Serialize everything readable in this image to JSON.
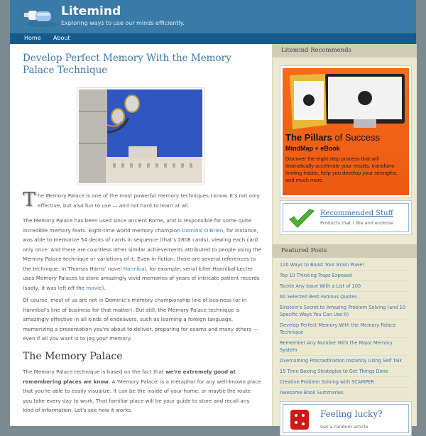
{
  "header": {
    "site_title": "Litemind",
    "tagline": "Exploring ways to use our minds efficiently."
  },
  "nav": {
    "items": [
      {
        "label": "Home"
      },
      {
        "label": "About"
      }
    ]
  },
  "post": {
    "title": "Develop Perfect Memory With the Memory Palace Technique",
    "image_alt": "Royal Palace of Madrid with street lamp",
    "p1_dropcap": "T",
    "p1": "he Memory Palace is one of the most powerful memory techniques I know. It's not only effective, but also fun to use — and not hard to learn at all.",
    "p2_a": "The Memory Palace has been used since ancient Rome, and is responsible for some quite incredible memory feats. Eight-time world memory champion ",
    "p2_link1": "Dominic O'Brien",
    "p2_b": ", for instance, was able to memorize 54 decks of cards in sequence (that's 2808 cards), viewing each card only once. And there are countless other similar achievements attributed to people using the Memory Palace technique or variations of it. Even in fiction, there are several references to the technique. In Thomas Harris' novel ",
    "p2_link2": "Hannibal",
    "p2_c": ", for example, serial killer Hannibal Lecter uses Memory Palaces to store amazingly vivid memories of years of intricate patient records (sadly, it was left off the ",
    "p2_link3": "movie",
    "p2_d": ").",
    "p3": "Of course, most of us are not in Dominic's memory championship line of business (or in Hannibal's line of business for that matter). But still, the Memory Palace technique is amazingly effective in all kinds of endeavors, such as learning a foreign language, memorizing a presentation you're about to deliver, preparing for exams and many others — even if all you want is to jog your memory.",
    "h2": "The Memory Palace",
    "p4_a": "The Memory Palace technique is based on the fact that ",
    "p4_bold": "we're extremely good at remembering places we know",
    "p4_b": ". A 'Memory Palace' is a metaphor for any well-known place that you're able to easily visualize. It can be the inside of your home, or maybe the route you take every day to work. That familiar place will be your guide to store and recall any kind of information. Let's see how it works."
  },
  "sidebar": {
    "recommends_heading": "Litemind Recommends",
    "ad": {
      "book_label": "The Pillars of Success",
      "title_bold": "The Pillars",
      "title_rest": " of Success",
      "subtitle": "MindMap + eBook",
      "description": "Discover the eight step process that will dramatically accelerate your results, transform limiting habits, help you develop your strengths, and much more."
    },
    "recommended": {
      "title": "Recommended Stuff",
      "subtitle": "Products that I like and endorse"
    },
    "featured_heading": "Featured Posts",
    "featured": [
      "120 Ways to Boost Your Brain Power",
      "Top 10 Thinking Traps Exposed",
      "Tackle Any Issue With a List of 100",
      "60 Selected Best Famous Quotes",
      "Einstein's Secret to Amazing Problem Solving (and 10 Specific Ways You Can Use It)",
      "Develop Perfect Memory With the Memory Palace Technique",
      "Remember Any Number With the Major Memory System",
      "Overcoming Procrastination Instantly Using Self Talk",
      "15 Time Boxing Strategies to Get Things Done",
      "Creative Problem Solving with SCAMPER",
      "Awesome Book Summaries"
    ],
    "lucky": {
      "title": "Feeling lucky?",
      "subtitle": "Get a random article"
    }
  }
}
